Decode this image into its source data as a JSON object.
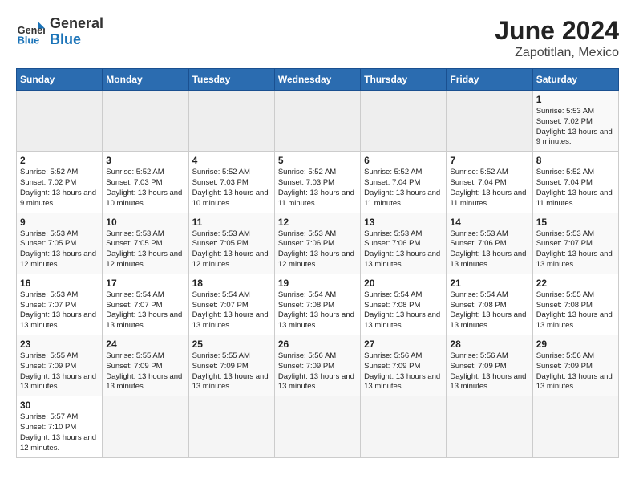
{
  "header": {
    "logo_general": "General",
    "logo_blue": "Blue",
    "title": "June 2024",
    "subtitle": "Zapotitlan, Mexico"
  },
  "weekdays": [
    "Sunday",
    "Monday",
    "Tuesday",
    "Wednesday",
    "Thursday",
    "Friday",
    "Saturday"
  ],
  "weeks": [
    [
      {
        "day": "",
        "info": "",
        "empty": true
      },
      {
        "day": "",
        "info": "",
        "empty": true
      },
      {
        "day": "",
        "info": "",
        "empty": true
      },
      {
        "day": "",
        "info": "",
        "empty": true
      },
      {
        "day": "",
        "info": "",
        "empty": true
      },
      {
        "day": "",
        "info": "",
        "empty": true
      },
      {
        "day": "1",
        "info": "Sunrise: 5:53 AM\nSunset: 7:02 PM\nDaylight: 13 hours\nand 9 minutes.",
        "empty": false
      }
    ],
    [
      {
        "day": "2",
        "info": "Sunrise: 5:52 AM\nSunset: 7:02 PM\nDaylight: 13 hours\nand 9 minutes.",
        "empty": false
      },
      {
        "day": "3",
        "info": "Sunrise: 5:52 AM\nSunset: 7:03 PM\nDaylight: 13 hours\nand 10 minutes.",
        "empty": false
      },
      {
        "day": "4",
        "info": "Sunrise: 5:52 AM\nSunset: 7:03 PM\nDaylight: 13 hours\nand 10 minutes.",
        "empty": false
      },
      {
        "day": "5",
        "info": "Sunrise: 5:52 AM\nSunset: 7:03 PM\nDaylight: 13 hours\nand 11 minutes.",
        "empty": false
      },
      {
        "day": "6",
        "info": "Sunrise: 5:52 AM\nSunset: 7:04 PM\nDaylight: 13 hours\nand 11 minutes.",
        "empty": false
      },
      {
        "day": "7",
        "info": "Sunrise: 5:52 AM\nSunset: 7:04 PM\nDaylight: 13 hours\nand 11 minutes.",
        "empty": false
      },
      {
        "day": "8",
        "info": "Sunrise: 5:52 AM\nSunset: 7:04 PM\nDaylight: 13 hours\nand 11 minutes.",
        "empty": false
      }
    ],
    [
      {
        "day": "9",
        "info": "Sunrise: 5:53 AM\nSunset: 7:05 PM\nDaylight: 13 hours\nand 12 minutes.",
        "empty": false
      },
      {
        "day": "10",
        "info": "Sunrise: 5:53 AM\nSunset: 7:05 PM\nDaylight: 13 hours\nand 12 minutes.",
        "empty": false
      },
      {
        "day": "11",
        "info": "Sunrise: 5:53 AM\nSunset: 7:05 PM\nDaylight: 13 hours\nand 12 minutes.",
        "empty": false
      },
      {
        "day": "12",
        "info": "Sunrise: 5:53 AM\nSunset: 7:06 PM\nDaylight: 13 hours\nand 12 minutes.",
        "empty": false
      },
      {
        "day": "13",
        "info": "Sunrise: 5:53 AM\nSunset: 7:06 PM\nDaylight: 13 hours\nand 13 minutes.",
        "empty": false
      },
      {
        "day": "14",
        "info": "Sunrise: 5:53 AM\nSunset: 7:06 PM\nDaylight: 13 hours\nand 13 minutes.",
        "empty": false
      },
      {
        "day": "15",
        "info": "Sunrise: 5:53 AM\nSunset: 7:07 PM\nDaylight: 13 hours\nand 13 minutes.",
        "empty": false
      }
    ],
    [
      {
        "day": "16",
        "info": "Sunrise: 5:53 AM\nSunset: 7:07 PM\nDaylight: 13 hours\nand 13 minutes.",
        "empty": false
      },
      {
        "day": "17",
        "info": "Sunrise: 5:54 AM\nSunset: 7:07 PM\nDaylight: 13 hours\nand 13 minutes.",
        "empty": false
      },
      {
        "day": "18",
        "info": "Sunrise: 5:54 AM\nSunset: 7:07 PM\nDaylight: 13 hours\nand 13 minutes.",
        "empty": false
      },
      {
        "day": "19",
        "info": "Sunrise: 5:54 AM\nSunset: 7:08 PM\nDaylight: 13 hours\nand 13 minutes.",
        "empty": false
      },
      {
        "day": "20",
        "info": "Sunrise: 5:54 AM\nSunset: 7:08 PM\nDaylight: 13 hours\nand 13 minutes.",
        "empty": false
      },
      {
        "day": "21",
        "info": "Sunrise: 5:54 AM\nSunset: 7:08 PM\nDaylight: 13 hours\nand 13 minutes.",
        "empty": false
      },
      {
        "day": "22",
        "info": "Sunrise: 5:55 AM\nSunset: 7:08 PM\nDaylight: 13 hours\nand 13 minutes.",
        "empty": false
      }
    ],
    [
      {
        "day": "23",
        "info": "Sunrise: 5:55 AM\nSunset: 7:09 PM\nDaylight: 13 hours\nand 13 minutes.",
        "empty": false
      },
      {
        "day": "24",
        "info": "Sunrise: 5:55 AM\nSunset: 7:09 PM\nDaylight: 13 hours\nand 13 minutes.",
        "empty": false
      },
      {
        "day": "25",
        "info": "Sunrise: 5:55 AM\nSunset: 7:09 PM\nDaylight: 13 hours\nand 13 minutes.",
        "empty": false
      },
      {
        "day": "26",
        "info": "Sunrise: 5:56 AM\nSunset: 7:09 PM\nDaylight: 13 hours\nand 13 minutes.",
        "empty": false
      },
      {
        "day": "27",
        "info": "Sunrise: 5:56 AM\nSunset: 7:09 PM\nDaylight: 13 hours\nand 13 minutes.",
        "empty": false
      },
      {
        "day": "28",
        "info": "Sunrise: 5:56 AM\nSunset: 7:09 PM\nDaylight: 13 hours\nand 13 minutes.",
        "empty": false
      },
      {
        "day": "29",
        "info": "Sunrise: 5:56 AM\nSunset: 7:09 PM\nDaylight: 13 hours\nand 13 minutes.",
        "empty": false
      }
    ],
    [
      {
        "day": "30",
        "info": "Sunrise: 5:57 AM\nSunset: 7:10 PM\nDaylight: 13 hours\nand 12 minutes.",
        "empty": false
      },
      {
        "day": "",
        "info": "",
        "empty": true
      },
      {
        "day": "",
        "info": "",
        "empty": true
      },
      {
        "day": "",
        "info": "",
        "empty": true
      },
      {
        "day": "",
        "info": "",
        "empty": true
      },
      {
        "day": "",
        "info": "",
        "empty": true
      },
      {
        "day": "",
        "info": "",
        "empty": true
      }
    ]
  ]
}
